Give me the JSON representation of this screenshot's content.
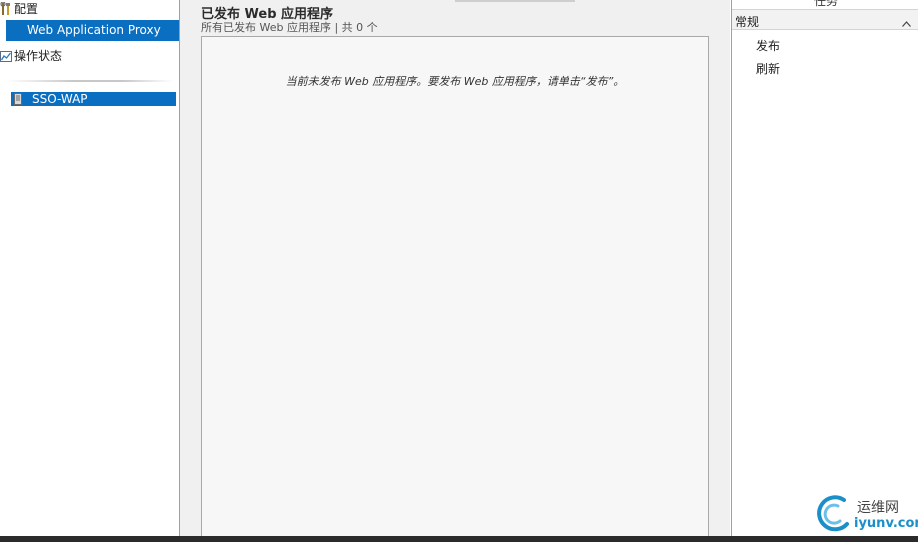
{
  "nav": {
    "config_label": "配置",
    "selected_item_label": "Web Application Proxy",
    "status_label": "操作状态",
    "server_label": "SSO-WAP"
  },
  "content": {
    "title": "已发布 Web 应用程序",
    "subtitle": "所有已发布 Web 应用程序 | 共 0 个",
    "empty_message": "当前未发布 Web 应用程序。要发布 Web 应用程序，请单击“发布”。"
  },
  "tasks": {
    "header_label": "任务",
    "section_label": "常规",
    "items": [
      {
        "label": "发布"
      },
      {
        "label": "刷新"
      }
    ]
  },
  "watermark": {
    "site_name": "运维网",
    "domain": "iyunv.com",
    "accent_color": "#1a8fc8"
  },
  "colors": {
    "selection": "#0b6fc1",
    "panel_background": "#f0f0f0",
    "list_background": "#f7f7f7"
  }
}
